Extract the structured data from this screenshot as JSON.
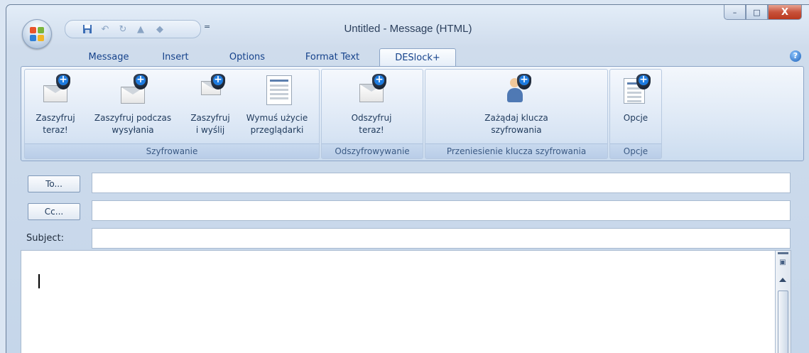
{
  "window": {
    "title": "Untitled - Message (HTML)",
    "caption_buttons": [
      "minimize-icon",
      "maximize-icon",
      "close-icon"
    ],
    "close_glyph": "X"
  },
  "quick_access": {
    "icons": [
      "save-icon",
      "undo-icon",
      "redo-icon",
      "previous-icon",
      "next-icon"
    ],
    "more_glyph": "="
  },
  "tabs": [
    {
      "label": "Message",
      "active": false
    },
    {
      "label": "Insert",
      "active": false
    },
    {
      "label": "Options",
      "active": false
    },
    {
      "label": "Format Text",
      "active": false
    },
    {
      "label": "DESlock+",
      "active": true
    }
  ],
  "ribbon": {
    "groups": [
      {
        "label": "Szyfrowanie",
        "buttons": [
          {
            "label": "Zaszyfruj\nteraz!",
            "icon": "encrypt-envelope-icon"
          },
          {
            "label": "Zaszyfruj podczas\nwysyłania",
            "icon": "encrypt-on-send-icon"
          },
          {
            "label": "Zaszyfruj\ni wyślij",
            "icon": "encrypt-and-send-icon"
          },
          {
            "label": "Wymuś użycie\nprzeglądarki",
            "icon": "force-viewer-icon"
          }
        ]
      },
      {
        "label": "Odszyfrowywanie",
        "buttons": [
          {
            "label": "Odszyfruj\nteraz!",
            "icon": "decrypt-envelope-icon"
          }
        ]
      },
      {
        "label": "Przeniesienie klucza szyfrowania",
        "buttons": [
          {
            "label": "Zażądaj klucza\nszyfrowania",
            "icon": "request-key-icon"
          }
        ]
      },
      {
        "label": "Opcje",
        "buttons": [
          {
            "label": "Opcje",
            "icon": "options-icon"
          }
        ]
      }
    ]
  },
  "compose": {
    "to_button": "To...",
    "cc_button": "Cc...",
    "subject_label": "Subject:",
    "to_value": "",
    "cc_value": "",
    "subject_value": ""
  },
  "colors": {
    "accent": "#15428b",
    "ribbon_border": "#8ba4c6",
    "shield_badge": "#1d7be0"
  }
}
